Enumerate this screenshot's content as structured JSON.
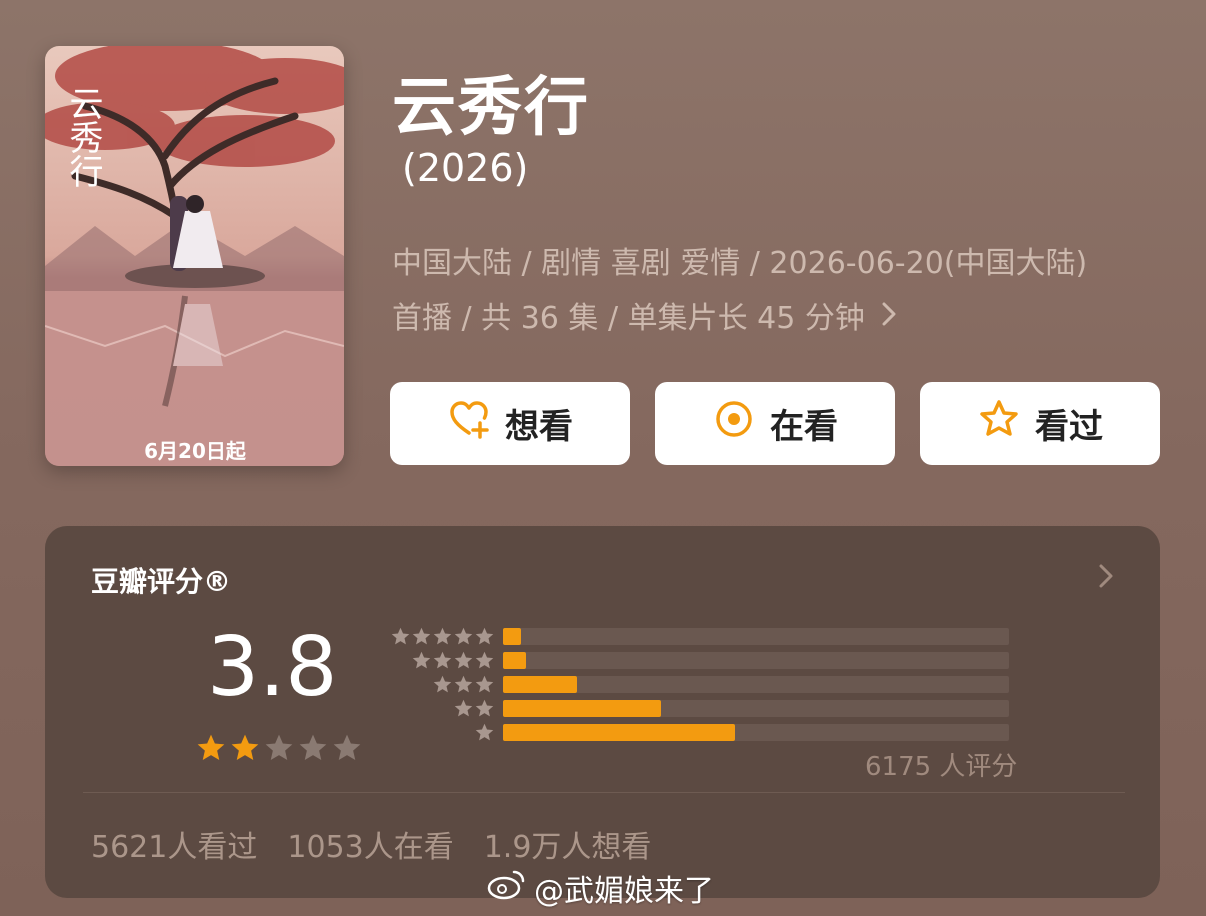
{
  "poster": {
    "tagline": "6月20日起",
    "logo_text": "云秀行"
  },
  "movie": {
    "title": "云秀行",
    "year": "(2026)",
    "meta_line1": "中国大陆 / 剧情 喜剧 爱情 / 2026-06-20(中国大陆)",
    "meta_line2": "首播 / 共 36 集 / 单集片长 45 分钟"
  },
  "actions": {
    "want": "想看",
    "watching": "在看",
    "watched": "看过"
  },
  "rating": {
    "title": "豆瓣评分®",
    "score": "3.8",
    "stars_filled": 2,
    "stars_total": 5,
    "distribution": [
      {
        "stars": 5,
        "fraction": 0.035
      },
      {
        "stars": 4,
        "fraction": 0.045
      },
      {
        "stars": 3,
        "fraction": 0.146
      },
      {
        "stars": 2,
        "fraction": 0.312
      },
      {
        "stars": 1,
        "fraction": 0.458
      }
    ],
    "count_label": "6175 人评分",
    "stats": {
      "watched": "5621人看过",
      "watching": "1053人在看",
      "want": "1.9万人想看"
    }
  },
  "watermark": "@武媚娘来了",
  "colors": {
    "accent": "#f39b10",
    "card_bg": "#5c4a42",
    "page_bg": "#8a7066"
  }
}
